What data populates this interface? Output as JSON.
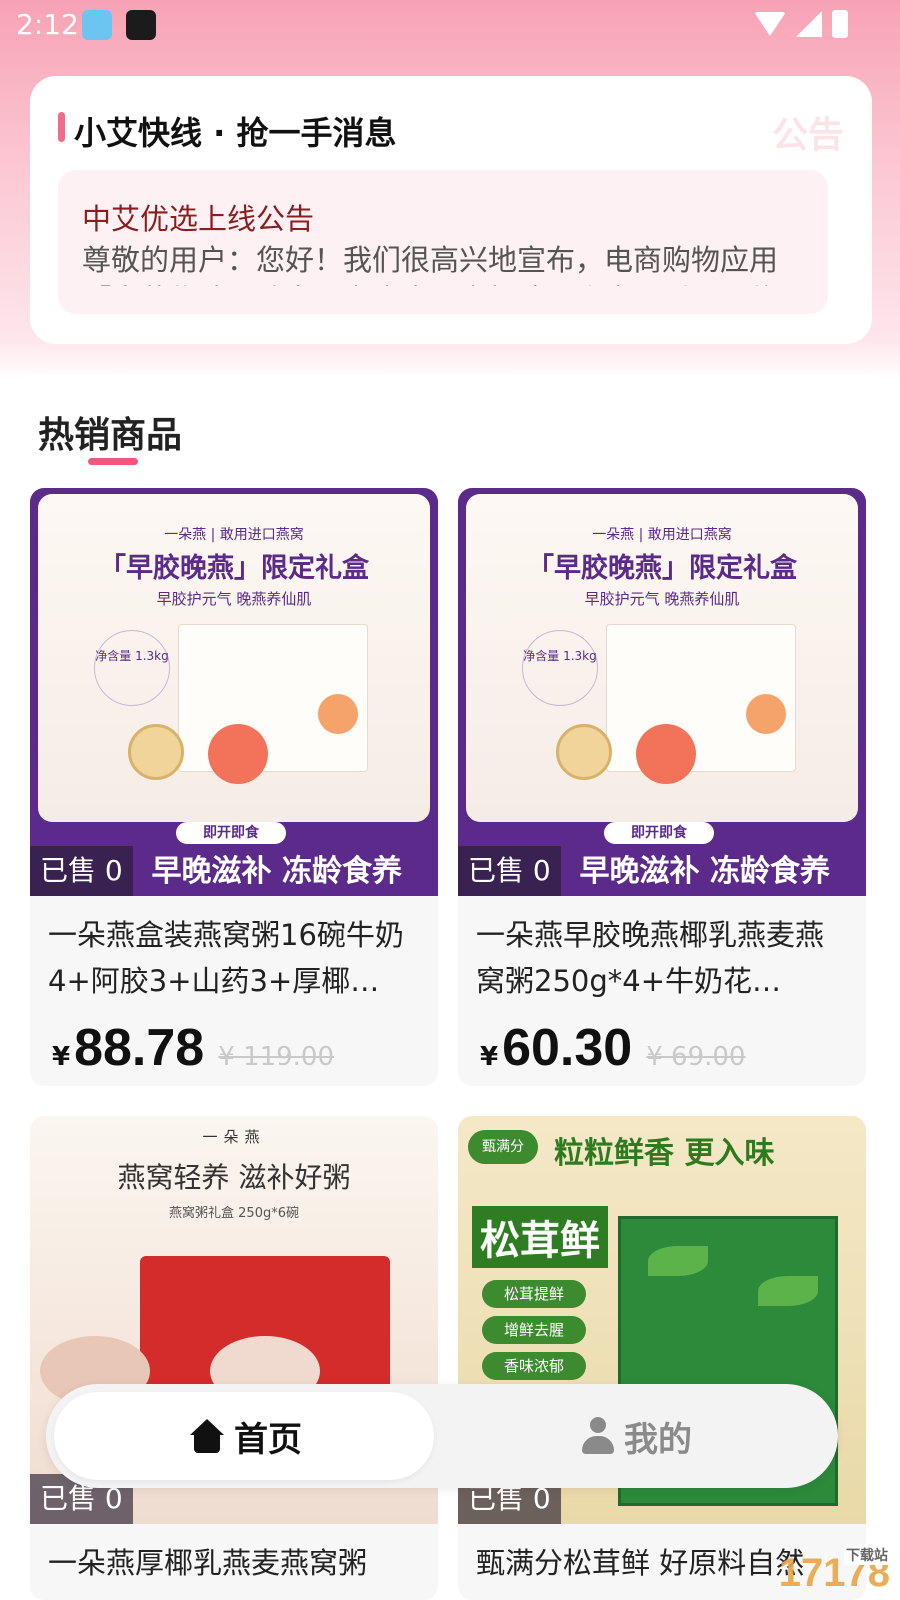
{
  "status_bar": {
    "time": "2:12"
  },
  "notice": {
    "title": "小艾快线 · 抢一手消息",
    "watermark": "公告",
    "head": "中艾优选上线公告",
    "body": "尊敬的用户：您好！我们很高兴地宣布，电商购物应用「中艾优选」致力于为广大用户打造一个高品质、可信赖"
  },
  "section": {
    "title": "热销商品"
  },
  "products": [
    {
      "sold": "已售 0",
      "name": "一朵燕盒装燕窝粥16碗牛奶4+阿胶3+山药3+厚椰…",
      "price_symbol": "¥",
      "price": "88.78",
      "original_price": "¥ 119.00",
      "art": {
        "brand": "一朵燕 | 敢用进口燕窝",
        "headline": "「早胶晚燕」限定礼盒",
        "sub": "早胶护元气 晚燕养仙肌",
        "net": "净含量 1.3kg",
        "pill": "即开即食",
        "bottom": "早晚滋补 冻龄食养"
      }
    },
    {
      "sold": "已售 0",
      "name": "一朵燕早胶晚燕椰乳燕麦燕窝粥250g*4+牛奶花…",
      "price_symbol": "¥",
      "price": "60.30",
      "original_price": "¥ 69.00",
      "art": {
        "brand": "一朵燕 | 敢用进口燕窝",
        "headline": "「早胶晚燕」限定礼盒",
        "sub": "早胶护元气 晚燕养仙肌",
        "net": "净含量 1.3kg",
        "pill": "即开即食",
        "bottom": "早晚滋补 冻龄食养"
      }
    },
    {
      "sold": "已售 0",
      "name": "一朵燕厚椰乳燕麦燕窝粥",
      "art": {
        "brand": "一朵燕",
        "headline": "燕窝轻养 滋补好粥",
        "sub": "燕窝粥礼盒 250g*6碗"
      }
    },
    {
      "sold": "已售 0",
      "name": "甄满分松茸鲜 好原料自然",
      "art": {
        "logo": "甄满分",
        "headline": "粒粒鲜香 更入味",
        "big": "松茸鲜",
        "tags": [
          "松茸提鲜",
          "增鲜去腥",
          "香味浓郁"
        ]
      }
    }
  ],
  "bottom_nav": {
    "home_label": "首页",
    "mine_label": "我的"
  },
  "watermark": {
    "text": "17178",
    "sub": "下载站"
  }
}
